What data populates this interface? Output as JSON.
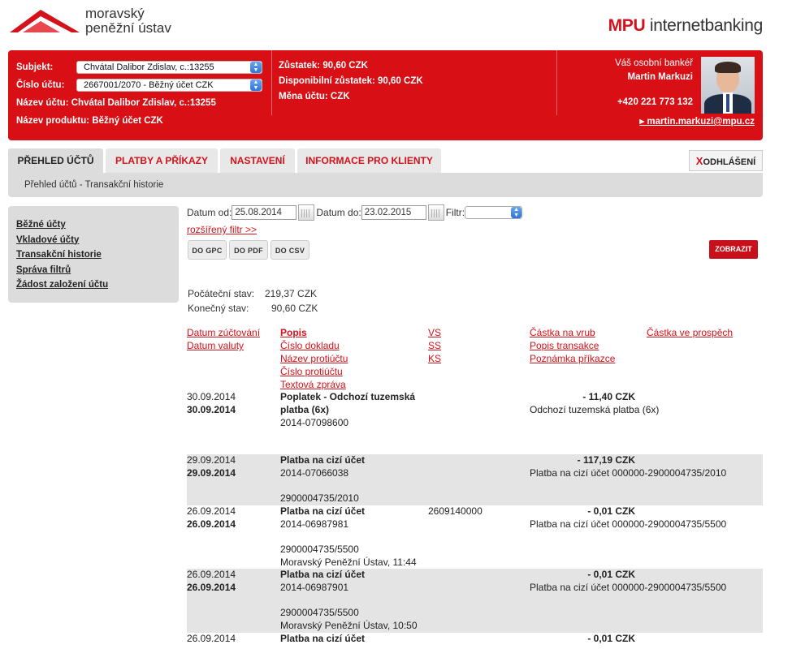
{
  "brand": {
    "logo_line1": "moravský",
    "logo_line2": "peněžní ústav",
    "product_prefix": "MPU",
    "product_suffix": "internetbanking"
  },
  "header": {
    "subject_label": "Subjekt:",
    "subject_value": "Chvátal Dalibor Zdislav, c.:13255",
    "account_label": "Číslo účtu:",
    "account_value": "2667001/2070 - Běžný účet CZK",
    "account_name": "Název účtu: Chvátal Dalibor Zdislav, c.:13255",
    "product_name": "Název produktu: Běžný účet CZK",
    "balance_label": "Zůstatek:",
    "balance_value": "90,60 CZK",
    "available": "Disponibilní zůstatek: 90,60 CZK",
    "currency": "Měna účtu: CZK",
    "banker_title": "Váš osobní bankéř",
    "banker_name": "Martin Markuzi",
    "banker_phone": "+420 221 773 132",
    "banker_email": "martin.markuzi@mpu.cz"
  },
  "tabs": [
    "PŘEHLED ÚČTŮ",
    "PLATBY A PŘÍKAZY",
    "NASTAVENÍ",
    "INFORMACE PRO KLIENTY"
  ],
  "logout_x": "X",
  "logout_label": "ODHLÁŠENÍ",
  "breadcrumb": "Přehled účtů - Transakční historie",
  "sidebar": [
    "Běžné účty",
    "Vkladové účty",
    "Transakční historie",
    "Správa filtrů",
    "Žádost založení účtu"
  ],
  "filter": {
    "date_from_label": "Datum od:",
    "date_from": "25.08.2014",
    "date_to_label": "Datum do:",
    "date_to": "23.02.2015",
    "filter_label": "Filtr:",
    "extended": "rozšířený filtr >>",
    "export_gpc": "DO GPC",
    "export_pdf": "DO PDF",
    "export_csv": "DO CSV",
    "show": "ZOBRAZIT"
  },
  "balances": {
    "start_label": "Počáteční stav:",
    "start_value": "219,37 CZK",
    "end_label": "Konečný stav:",
    "end_value": "90,60 CZK"
  },
  "columns": {
    "c1": [
      "Datum zúčtování",
      "Datum valuty"
    ],
    "c2": [
      "Popis",
      "Číslo dokladu",
      "Název protiúčtu",
      "Číslo protiúčtu",
      "Textová zpráva"
    ],
    "c3": [
      "VS",
      "SS",
      "KS"
    ],
    "c4": [
      "Částka na vrub",
      "Popis transakce",
      "Poznámka příkazce"
    ],
    "c5": [
      "Částka ve prospěch"
    ]
  },
  "transactions": [
    {
      "date1": "30.09.2014",
      "date2": "30.09.2014",
      "desc": "Poplatek - Odchozí tuzemská",
      "desc2": "platba (6x)",
      "doc": "2014-07098600",
      "account": "",
      "message": "",
      "vs": "",
      "amount": "- 11,40 CZK",
      "ttype": "Odchozí tuzemská platba (6x)"
    },
    {
      "date1": "29.09.2014",
      "date2": "29.09.2014",
      "desc": "Platba na cizí účet",
      "desc2": "",
      "doc": "2014-07066038",
      "account": "2900004735/2010",
      "message": "",
      "vs": "",
      "amount": "- 117,19 CZK",
      "ttype": "Platba na cizí účet 000000-2900004735/2010"
    },
    {
      "date1": "26.09.2014",
      "date2": "26.09.2014",
      "desc": "Platba na cizí účet",
      "desc2": "",
      "doc": "2014-06987981",
      "account": "2900004735/5500",
      "message": "Moravský Peněžní Ústav, 11:44",
      "vs": "2609140000",
      "amount": "- 0,01 CZK",
      "ttype": "Platba na cizí účet 000000-2900004735/5500"
    },
    {
      "date1": "26.09.2014",
      "date2": "26.09.2014",
      "desc": "Platba na cizí účet",
      "desc2": "",
      "doc": "2014-06987901",
      "account": "2900004735/5500",
      "message": "Moravský Peněžní Ústav, 10:50",
      "vs": "",
      "amount": "- 0,01 CZK",
      "ttype": "Platba na cizí účet 000000-2900004735/5500"
    },
    {
      "date1": "26.09.2014",
      "date2": "",
      "desc": "Platba na cizí účet",
      "desc2": "",
      "doc": "",
      "account": "",
      "message": "",
      "vs": "",
      "amount": "- 0,01 CZK",
      "ttype": ""
    }
  ]
}
